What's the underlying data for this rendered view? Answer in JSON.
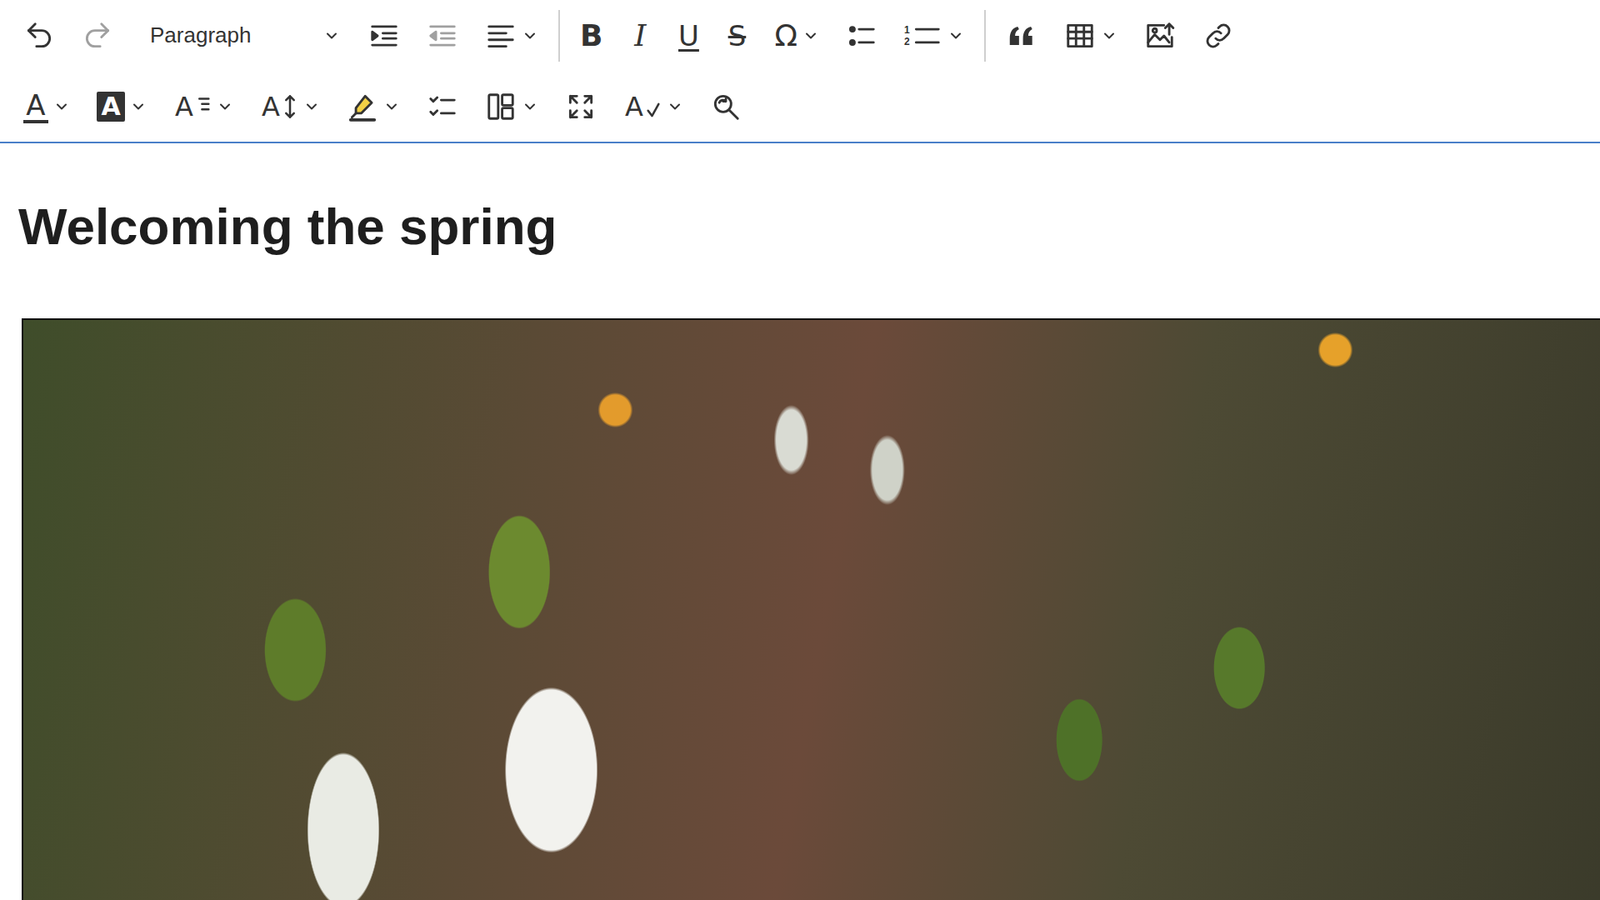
{
  "toolbar": {
    "rows": [
      [
        {
          "kind": "button",
          "disabled": false,
          "dropdown": false
        },
        {
          "kind": "button",
          "disabled": true,
          "dropdown": false
        },
        {
          "kind": "select",
          "text": "Paragraph",
          "disabled": false,
          "dropdown": true
        },
        {
          "kind": "button",
          "disabled": false,
          "dropdown": false
        },
        {
          "kind": "button",
          "disabled": true,
          "dropdown": false
        },
        {
          "kind": "button",
          "disabled": false,
          "dropdown": true
        },
        {
          "kind": "separator"
        },
        {
          "kind": "button",
          "text": "B",
          "disabled": false,
          "dropdown": false
        },
        {
          "kind": "button",
          "text": "I",
          "disabled": false,
          "dropdown": false
        },
        {
          "kind": "button",
          "text": "U",
          "disabled": false,
          "dropdown": false
        },
        {
          "kind": "button",
          "text": "S",
          "disabled": false,
          "dropdown": false
        },
        {
          "kind": "button",
          "text": "Ω",
          "disabled": false,
          "dropdown": true
        },
        {
          "kind": "button",
          "disabled": false,
          "dropdown": false
        },
        {
          "kind": "button",
          "marks": [
            "1",
            "2"
          ],
          "disabled": false,
          "dropdown": true
        },
        {
          "kind": "separator"
        },
        {
          "kind": "button",
          "disabled": false,
          "dropdown": false
        },
        {
          "kind": "button",
          "disabled": false,
          "dropdown": true
        },
        {
          "kind": "button",
          "disabled": false,
          "dropdown": false
        },
        {
          "kind": "button",
          "disabled": false,
          "dropdown": false
        }
      ],
      [
        {
          "kind": "button",
          "text": "A",
          "disabled": false,
          "dropdown": true
        },
        {
          "kind": "button",
          "text": "A",
          "disabled": false,
          "dropdown": true
        },
        {
          "kind": "button",
          "text": "A",
          "disabled": false,
          "dropdown": true
        },
        {
          "kind": "button",
          "text": "A",
          "disabled": false,
          "dropdown": true
        },
        {
          "kind": "button",
          "disabled": false,
          "dropdown": true
        },
        {
          "kind": "button",
          "disabled": false,
          "dropdown": false
        },
        {
          "kind": "button",
          "disabled": false,
          "dropdown": true
        },
        {
          "kind": "button",
          "disabled": false,
          "dropdown": false
        },
        {
          "kind": "button",
          "text": "A",
          "disabled": false,
          "dropdown": true
        },
        {
          "kind": "button",
          "disabled": false,
          "dropdown": false
        }
      ]
    ]
  },
  "document": {
    "heading": "Welcoming the spring"
  }
}
